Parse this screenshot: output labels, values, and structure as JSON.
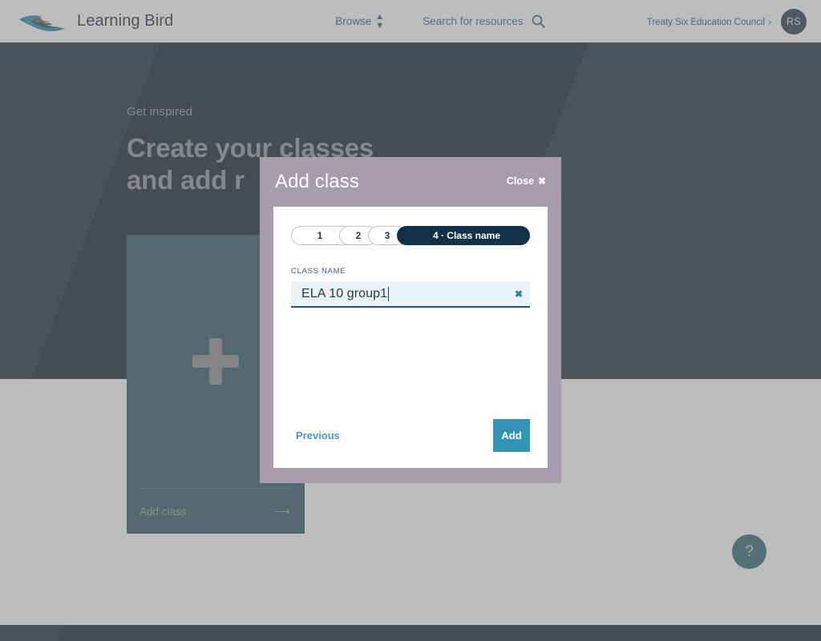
{
  "header": {
    "brand": "Learning Bird",
    "logo_icon": "bird-logo",
    "browse_label": "Browse",
    "browse_icon": "updown-caret-icon",
    "search_placeholder": "Search for resources",
    "search_icon": "search-icon",
    "org_name": "Treaty Six Education Council",
    "org_chevron": "›",
    "avatar_initials": "RS"
  },
  "hero": {
    "eyebrow": "Get inspired",
    "title": "Create your classes\nand add r"
  },
  "card": {
    "plus_icon": "plus-icon",
    "label": "Add class",
    "arrow_icon": "arrow-right-icon"
  },
  "help": {
    "icon": "question-mark-icon",
    "label": "?"
  },
  "modal": {
    "title": "Add class",
    "close_label": "Close",
    "close_icon": "✖",
    "steps": [
      {
        "label": "1",
        "active": false
      },
      {
        "label": "2",
        "active": false
      },
      {
        "label": "3",
        "active": false
      },
      {
        "label": "4 · Class name",
        "active": true
      }
    ],
    "field": {
      "label": "CLASS NAME",
      "value": "ELA 10 group1",
      "placeholder": "",
      "clear_icon": "✖"
    },
    "previous_label": "Previous",
    "add_label": "Add"
  },
  "colors": {
    "accent_teal": "#3494b5",
    "navy": "#123148",
    "hero_bg": "#04161f",
    "card_bg": "#24505c",
    "modal_frame": "#a79dad",
    "input_bg": "#eaf2f8",
    "input_underline": "#1d5285"
  }
}
